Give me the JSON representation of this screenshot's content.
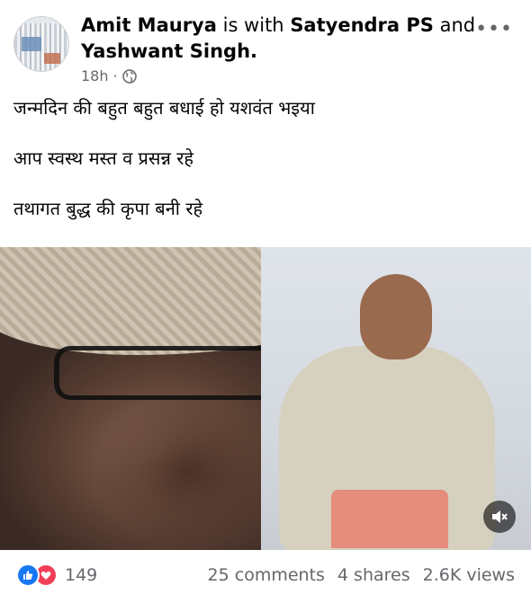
{
  "post": {
    "author": "Amit Maurya",
    "with_text": "is with",
    "tagged_1": "Satyendra PS",
    "and_text": "and",
    "tagged_2": "Yashwant Singh.",
    "time": "18h",
    "separator": "·",
    "more_icon": "more-dots-icon",
    "privacy_icon": "globe-icon"
  },
  "text": {
    "line1": "जन्मदिन की बहुत बहुत बधाई हो यशवंत भइया",
    "line2": "आप स्वस्थ मस्त व प्रसन्न रहे",
    "line3": "तथागत बुद्ध की कृपा बनी रहे"
  },
  "media": {
    "mute_icon": "speaker-muted-icon"
  },
  "footer": {
    "reaction_count": "149",
    "comments": "25 comments",
    "shares": "4 shares",
    "views": "2.6K views"
  },
  "colors": {
    "like_blue": "#1877f2",
    "love_red": "#f33e58",
    "meta_gray": "#65676b"
  }
}
